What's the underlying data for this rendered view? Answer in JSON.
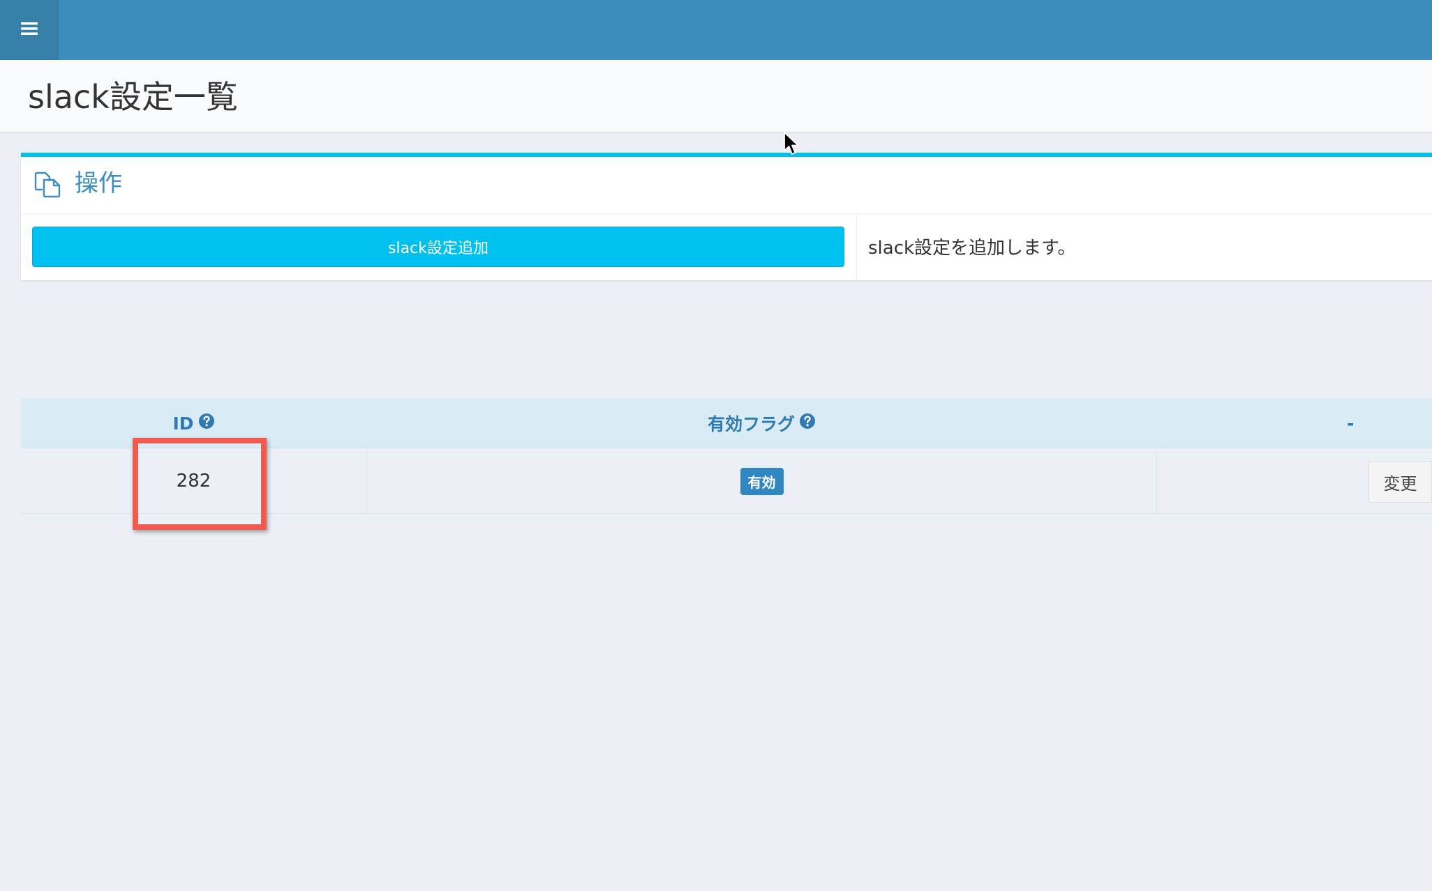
{
  "header": {
    "menu_icon": "hamburger-icon",
    "page_title": "slack設定一覧",
    "colors": {
      "topbar": "#3c8dbc",
      "toggle": "#367fa9"
    }
  },
  "operations": {
    "icon": "copy-icon",
    "title": "操作",
    "add_button_label": "slack設定追加",
    "add_description": "slack設定を追加します。",
    "accent_color": "#00c0ef"
  },
  "table": {
    "columns": [
      {
        "label": "ID",
        "help_icon": "question-circle-icon"
      },
      {
        "label": "有効フラグ",
        "help_icon": "question-circle-icon"
      },
      {
        "label": "-"
      }
    ],
    "rows": [
      {
        "id": "282",
        "status_badge": "有効",
        "action_label": "変更"
      }
    ]
  },
  "annotation": {
    "highlight_color": "#f05a4f"
  }
}
